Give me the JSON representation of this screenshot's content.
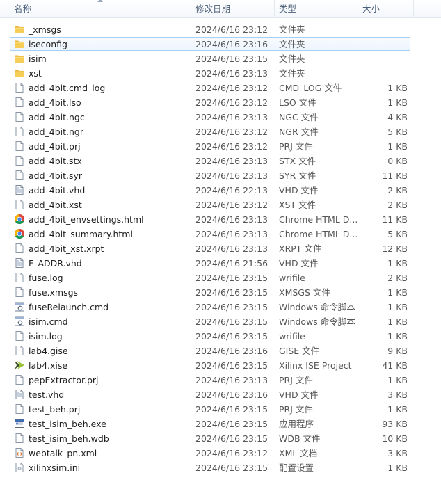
{
  "columns": {
    "name": "名称",
    "date": "修改日期",
    "type": "类型",
    "size": "大小"
  },
  "files": [
    {
      "name": "_xmsgs",
      "date": "2024/6/16 23:12",
      "type": "文件夹",
      "size": "",
      "icon": "folder"
    },
    {
      "name": "iseconfig",
      "date": "2024/6/16 23:16",
      "type": "文件夹",
      "size": "",
      "icon": "folder",
      "selected": true
    },
    {
      "name": "isim",
      "date": "2024/6/16 23:15",
      "type": "文件夹",
      "size": "",
      "icon": "folder"
    },
    {
      "name": "xst",
      "date": "2024/6/16 23:13",
      "type": "文件夹",
      "size": "",
      "icon": "folder"
    },
    {
      "name": "add_4bit.cmd_log",
      "date": "2024/6/16 23:12",
      "type": "CMD_LOG 文件",
      "size": "1 KB",
      "icon": "file"
    },
    {
      "name": "add_4bit.lso",
      "date": "2024/6/16 23:12",
      "type": "LSO 文件",
      "size": "1 KB",
      "icon": "file"
    },
    {
      "name": "add_4bit.ngc",
      "date": "2024/6/16 23:13",
      "type": "NGC 文件",
      "size": "4 KB",
      "icon": "file"
    },
    {
      "name": "add_4bit.ngr",
      "date": "2024/6/16 23:12",
      "type": "NGR 文件",
      "size": "5 KB",
      "icon": "file"
    },
    {
      "name": "add_4bit.prj",
      "date": "2024/6/16 23:12",
      "type": "PRJ 文件",
      "size": "1 KB",
      "icon": "file"
    },
    {
      "name": "add_4bit.stx",
      "date": "2024/6/16 23:13",
      "type": "STX 文件",
      "size": "0 KB",
      "icon": "file"
    },
    {
      "name": "add_4bit.syr",
      "date": "2024/6/16 23:13",
      "type": "SYR 文件",
      "size": "11 KB",
      "icon": "file"
    },
    {
      "name": "add_4bit.vhd",
      "date": "2024/6/16 22:13",
      "type": "VHD 文件",
      "size": "2 KB",
      "icon": "text-file"
    },
    {
      "name": "add_4bit.xst",
      "date": "2024/6/16 23:12",
      "type": "XST 文件",
      "size": "2 KB",
      "icon": "file"
    },
    {
      "name": "add_4bit_envsettings.html",
      "date": "2024/6/16 23:13",
      "type": "Chrome HTML D...",
      "size": "11 KB",
      "icon": "chrome"
    },
    {
      "name": "add_4bit_summary.html",
      "date": "2024/6/16 23:13",
      "type": "Chrome HTML D...",
      "size": "5 KB",
      "icon": "chrome"
    },
    {
      "name": "add_4bit_xst.xrpt",
      "date": "2024/6/16 23:13",
      "type": "XRPT 文件",
      "size": "12 KB",
      "icon": "file"
    },
    {
      "name": "F_ADDR.vhd",
      "date": "2024/6/16 21:56",
      "type": "VHD 文件",
      "size": "1 KB",
      "icon": "text-file"
    },
    {
      "name": "fuse.log",
      "date": "2024/6/16 23:15",
      "type": "wrifile",
      "size": "2 KB",
      "icon": "file"
    },
    {
      "name": "fuse.xmsgs",
      "date": "2024/6/16 23:15",
      "type": "XMSGS 文件",
      "size": "1 KB",
      "icon": "file"
    },
    {
      "name": "fuseRelaunch.cmd",
      "date": "2024/6/16 23:15",
      "type": "Windows 命令脚本",
      "size": "1 KB",
      "icon": "cmd"
    },
    {
      "name": "isim.cmd",
      "date": "2024/6/16 23:15",
      "type": "Windows 命令脚本",
      "size": "1 KB",
      "icon": "cmd"
    },
    {
      "name": "isim.log",
      "date": "2024/6/16 23:15",
      "type": "wrifile",
      "size": "1 KB",
      "icon": "file"
    },
    {
      "name": "lab4.gise",
      "date": "2024/6/16 23:16",
      "type": "GISE 文件",
      "size": "9 KB",
      "icon": "file"
    },
    {
      "name": "lab4.xise",
      "date": "2024/6/16 23:15",
      "type": "Xilinx ISE Project",
      "size": "41 KB",
      "icon": "xilinx"
    },
    {
      "name": "pepExtractor.prj",
      "date": "2024/6/16 23:13",
      "type": "PRJ 文件",
      "size": "1 KB",
      "icon": "file"
    },
    {
      "name": "test.vhd",
      "date": "2024/6/16 23:16",
      "type": "VHD 文件",
      "size": "3 KB",
      "icon": "text-file"
    },
    {
      "name": "test_beh.prj",
      "date": "2024/6/16 23:15",
      "type": "PRJ 文件",
      "size": "1 KB",
      "icon": "file"
    },
    {
      "name": "test_isim_beh.exe",
      "date": "2024/6/16 23:15",
      "type": "应用程序",
      "size": "93 KB",
      "icon": "exe"
    },
    {
      "name": "test_isim_beh.wdb",
      "date": "2024/6/16 23:15",
      "type": "WDB 文件",
      "size": "10 KB",
      "icon": "file"
    },
    {
      "name": "webtalk_pn.xml",
      "date": "2024/6/16 23:12",
      "type": "XML 文档",
      "size": "3 KB",
      "icon": "xml"
    },
    {
      "name": "xilinxsim.ini",
      "date": "2024/6/16 23:15",
      "type": "配置设置",
      "size": "1 KB",
      "icon": "ini"
    }
  ]
}
